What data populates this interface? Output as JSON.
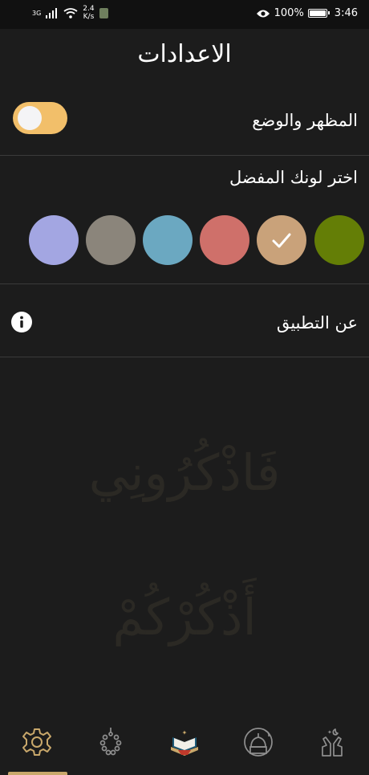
{
  "status_bar": {
    "network": "3G",
    "speed_value": "2.4",
    "speed_unit": "K/s",
    "battery": "100%",
    "time": "3:46"
  },
  "page": {
    "title": "الاعدادات"
  },
  "settings": {
    "appearance_label": "المظهر والوضع",
    "appearance_toggle_on": true,
    "color_label": "اختر لونك المفضل",
    "colors": [
      "#a3a6e2",
      "#8b857b",
      "#6ba8c1",
      "#cf706a",
      "#c9a27a",
      "#647e06"
    ],
    "selected_color": "#c9a27a",
    "about_label": "عن التطبيق"
  },
  "watermark": {
    "line1": "فَاذْكُرُونِي",
    "line2": "أَذْكُرْكُمْ"
  },
  "navbar": {
    "items": [
      "settings",
      "prayer-beads",
      "quran",
      "mosque",
      "supplication"
    ],
    "active": "settings",
    "accent_color": "#c9a86b"
  }
}
